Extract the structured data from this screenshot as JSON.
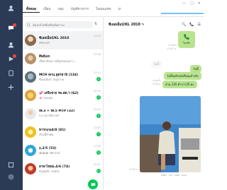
{
  "tabs": [
    {
      "label": "ทั้งหมด",
      "active": true
    },
    {
      "label": "เพื่อน",
      "active": false
    },
    {
      "label": "กลุ่ม",
      "active": false
    },
    {
      "label": "บัญชีทางการ",
      "active": false
    },
    {
      "label": "โอเพนแชท",
      "active": false
    },
    {
      "label": "⇄",
      "active": false
    }
  ],
  "window_controls": [
    "—",
    "□",
    "✕"
  ],
  "search": {
    "placeholder": "ค้นหาด้วยชื่อหรือข้อความ",
    "sort_label": "⇅"
  },
  "chats": [
    {
      "name": "ซีเอสเอ็มบ์/KL 2010",
      "preview": "สติกเกอร์",
      "time": "13:59",
      "unread": "",
      "avatar_color": "#8a6b4e",
      "selected": true
    },
    {
      "name": "ศิษย์เอก",
      "preview": "เนื้อหาข้อความนี้ถูกซ่อนเพราะ...",
      "time": "13:48",
      "unread": "",
      "avatar_color": "#b7906b",
      "selected": false
    },
    {
      "name": "MCH คกน.อุดรธานี (134)",
      "preview": "ซีเอสเอ็มบ์: ส่งรูปภาพ",
      "time": "13:11",
      "unread": "2",
      "avatar_color": "#5b6f7c",
      "selected": false
    },
    {
      "name": "💞 เครือข่าย รพ.สต.ฯ (62)",
      "preview": "🌸 ขอบคุณ",
      "time": "12:40",
      "unread": "4",
      "avatar_color": "#d9a441",
      "selected": false
    },
    {
      "name": "W.3 + W.5 MTP (32)",
      "preview": "นาง ส่ง สติกเกอร์",
      "time": "12:22",
      "unread": "9",
      "avatar_color": "#e7e9ee",
      "selected": false
    },
    {
      "name": "ทารกเกอ4/8 (81)",
      "preview": "เรื่องนี้สำคัญ",
      "time": "11:50",
      "unread": "1",
      "avatar_color": "#f0c020",
      "selected": false
    },
    {
      "name": "อ.2/5 (53)",
      "preview": "😂😂😂 สติกเกอร์",
      "time": "11:05",
      "unread": "3",
      "avatar_color": "#2ea8d8",
      "selected": false
    },
    {
      "name": "ฮาษาไทยม.4/6 (74)",
      "preview": "ครูสมศรี: เก่งครับ",
      "time": "10:31",
      "unread": "12",
      "avatar_color": "#c23b2c",
      "selected": false
    }
  ],
  "conversation": {
    "title": "ซีเอสเอ็มบ์/KL 2010 ✎",
    "header_icons": [
      "🔍",
      "📞",
      "☰"
    ],
    "call_label": "โทรอีก",
    "call_stamp": "อ่านแล้ว\n13:47 น.",
    "date_chip": "วันนี้",
    "msg1": "วันนี้",
    "msg2": "วันนี้ขอรับบทเรียนแล้วจร้ะ",
    "msg3": "ส่วน 135 ต่ำกว่า25 ค่ะ",
    "msg_stamp": "อ่านแล้ว\n13:58 น.",
    "photo_stamp": "13:59 น.",
    "photo_footer": "บันทึก · แชร์ · ส่งต่อ · Keep · ...",
    "colors": {
      "accent": "#06c755",
      "bubble": "#b8e48f",
      "rail": "#2b3a55"
    }
  }
}
